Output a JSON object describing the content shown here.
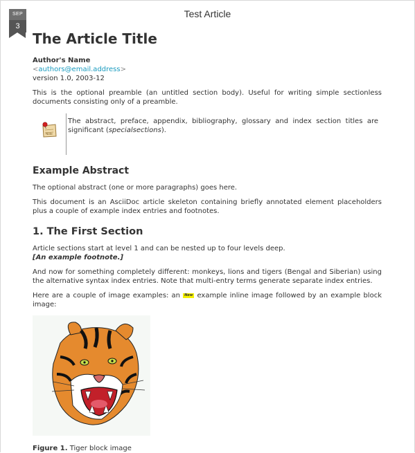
{
  "window": {
    "title": "Test Article"
  },
  "date_badge": {
    "month": "SEP",
    "day": "3"
  },
  "article": {
    "title": "The Article Title",
    "author_name": "Author's Name",
    "email_lt": "<",
    "email": "authors@email.address",
    "email_gt": ">",
    "version": "version 1.0, 2003-12",
    "preamble": "This is the optional preamble (an untitled section body). Useful for writing simple sectionless documents consisting only of a preamble.",
    "note": {
      "text_before": "The abstract, preface, appendix, bibliography, glossary and index section titles are significant (",
      "text_italic": "specialsections",
      "text_after": ").",
      "icon_label": "Note"
    },
    "abstract": {
      "heading": "Example Abstract",
      "p1": "The optional abstract (one or more paragraphs) goes here.",
      "p2": "This document is an AsciiDoc article skeleton containing briefly annotated element placeholders plus a couple of example index entries and footnotes."
    },
    "section1": {
      "heading": "1. The First Section",
      "p1": "Article sections start at level 1 and can be nested up to four levels deep.",
      "footnote": "[An example footnote.]",
      "p2": "And now for something completely different: monkeys, lions and tigers (Bengal and Siberian) using the alternative syntax index entries. Note that multi-entry terms generate separate index entries.",
      "p3_before": "Here are a couple of image examples: an ",
      "inline_image_label": "New",
      "p3_after": " example inline image followed by an example block image:",
      "figure_label": "Figure 1.",
      "figure_caption": "Tiger block image"
    }
  }
}
